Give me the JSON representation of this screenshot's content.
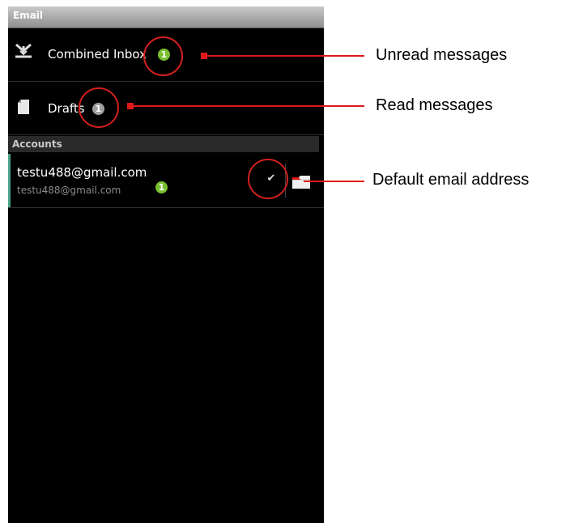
{
  "app": {
    "title": "Email"
  },
  "folders": [
    {
      "label": "Combined Inbox",
      "icon": "combined-inbox-icon",
      "count": "1",
      "badge_color": "#78c030"
    },
    {
      "label": "Drafts",
      "icon": "drafts-icon",
      "count": "1",
      "badge_color": "#a0a0a0"
    }
  ],
  "accounts_section": {
    "header": "Accounts"
  },
  "accounts": [
    {
      "name": "testu488@gmail.com",
      "address": "testu488@gmail.com",
      "count": "1",
      "is_default": true
    }
  ],
  "annotations": [
    {
      "label": "Unread messages"
    },
    {
      "label": "Read messages"
    },
    {
      "label": "Default email address"
    }
  ],
  "colors": {
    "annotation_red": "#e01818",
    "unread_badge": "#78c030",
    "read_badge": "#a0a0a0",
    "account_accent": "#4aa38a"
  }
}
